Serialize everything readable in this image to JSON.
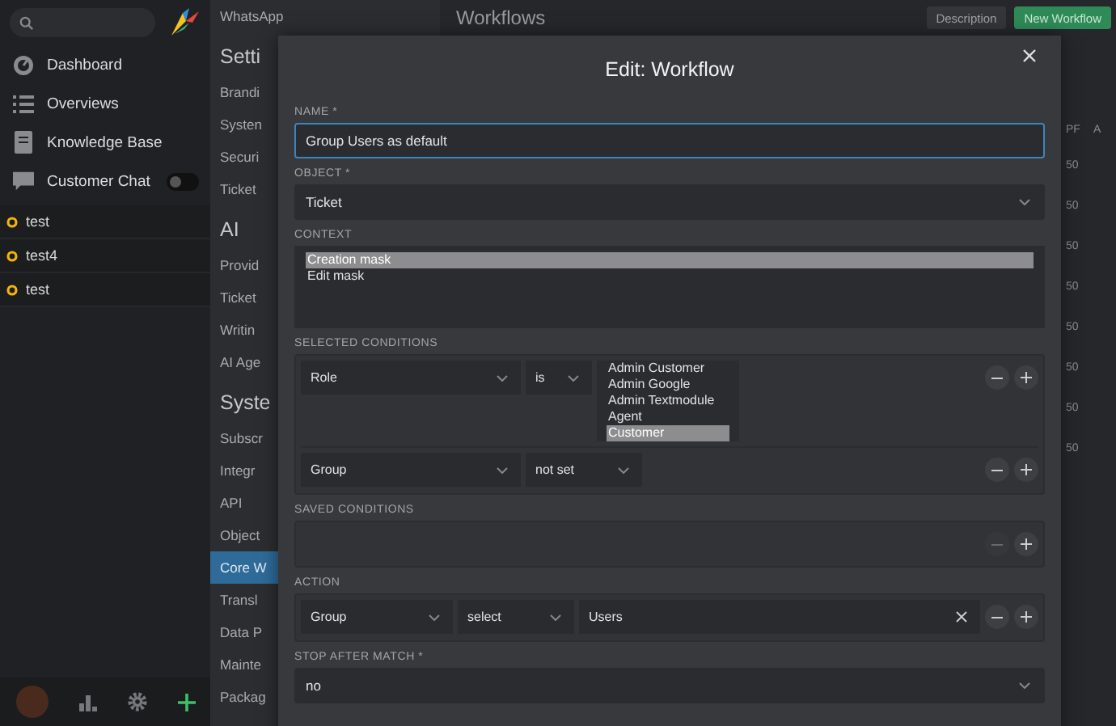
{
  "sidebar": {
    "nav": [
      {
        "label": "Dashboard"
      },
      {
        "label": "Overviews"
      },
      {
        "label": "Knowledge Base"
      },
      {
        "label": "Customer Chat",
        "toggle": {
          "on": false
        }
      }
    ],
    "tasks": [
      {
        "label": "test"
      },
      {
        "label": "test4"
      },
      {
        "label": "test"
      }
    ]
  },
  "settings_nav": [
    {
      "kind": "item",
      "label": "WhatsApp",
      "selected": false
    },
    {
      "kind": "heading",
      "label": "Setti"
    },
    {
      "kind": "item",
      "label": "Brandi",
      "selected": false
    },
    {
      "kind": "item",
      "label": "Systen",
      "selected": false
    },
    {
      "kind": "item",
      "label": "Securi",
      "selected": false
    },
    {
      "kind": "item",
      "label": "Ticket",
      "selected": false
    },
    {
      "kind": "heading",
      "label": "AI"
    },
    {
      "kind": "item",
      "label": "Provid",
      "selected": false
    },
    {
      "kind": "item",
      "label": "Ticket",
      "selected": false
    },
    {
      "kind": "item",
      "label": "Writin",
      "selected": false
    },
    {
      "kind": "item",
      "label": "AI Age",
      "selected": false
    },
    {
      "kind": "heading",
      "label": "Syste"
    },
    {
      "kind": "item",
      "label": "Subscr",
      "selected": false
    },
    {
      "kind": "item",
      "label": "Integr",
      "selected": false
    },
    {
      "kind": "item",
      "label": "API",
      "selected": false
    },
    {
      "kind": "item",
      "label": "Object",
      "selected": false
    },
    {
      "kind": "item",
      "label": "Core W",
      "selected": true
    },
    {
      "kind": "item",
      "label": "Transl",
      "selected": false
    },
    {
      "kind": "item",
      "label": "Data P",
      "selected": false
    },
    {
      "kind": "item",
      "label": "Mainte",
      "selected": false
    },
    {
      "kind": "item",
      "label": "Packag",
      "selected": false
    }
  ],
  "main": {
    "title": "Workflows",
    "buttons": [
      {
        "label": "Description",
        "kind": "secondary"
      },
      {
        "label": "New Workflow",
        "kind": "primary"
      }
    ],
    "table": {
      "columns": [
        "PF",
        "A"
      ],
      "rows": [
        "50",
        "50",
        "50",
        "50",
        "50",
        "50",
        "50",
        "50"
      ]
    }
  },
  "modal": {
    "title": "Edit: Workflow",
    "name": {
      "label": "NAME *",
      "value": "Group Users as default"
    },
    "object": {
      "label": "OBJECT *",
      "value": "Ticket"
    },
    "context": {
      "label": "CONTEXT",
      "options": [
        {
          "label": "Creation mask",
          "selected": true
        },
        {
          "label": "Edit mask",
          "selected": false
        }
      ]
    },
    "selected_conditions": {
      "label": "SELECTED CONDITIONS",
      "rows": [
        {
          "attribute": "Role",
          "operator": "is",
          "kind": "multiselect",
          "options": [
            {
              "label": "Admin Customer",
              "selected": false
            },
            {
              "label": "Admin Google",
              "selected": false
            },
            {
              "label": "Admin Textmodule",
              "selected": false
            },
            {
              "label": "Agent",
              "selected": false
            },
            {
              "label": "Customer",
              "selected": true
            }
          ]
        },
        {
          "attribute": "Group",
          "operator": "not set",
          "kind": "none"
        }
      ]
    },
    "saved_conditions": {
      "label": "SAVED CONDITIONS",
      "remove_disabled": true
    },
    "action": {
      "label": "ACTION",
      "attribute": "Group",
      "operator": "select",
      "value": "Users"
    },
    "stop_after_match": {
      "label": "STOP AFTER MATCH *",
      "value": "no"
    }
  }
}
